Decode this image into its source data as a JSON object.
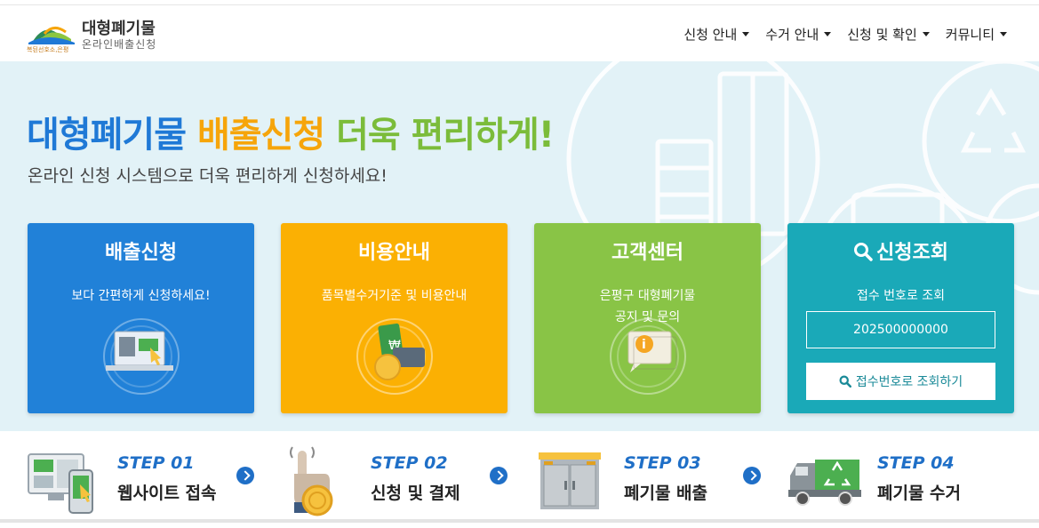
{
  "header": {
    "logo_title": "대형폐기물",
    "logo_subtitle": "온라인배출신청",
    "logo_tiny": "복된선호소,은평",
    "nav": [
      {
        "label": "신청 안내"
      },
      {
        "label": "수거 안내"
      },
      {
        "label": "신청 및 확인"
      },
      {
        "label": "커뮤니티"
      }
    ]
  },
  "hero": {
    "title_part1": "대형폐기물",
    "title_part2": "배출신청",
    "title_part3": "더욱 편리하게!",
    "subtitle": "온라인 신청 시스템으로 더욱 편리하게 신청하세요!",
    "colors": {
      "blue": "#1f79d6",
      "orange": "#f6a50a",
      "green": "#7bbc3a"
    }
  },
  "cards": [
    {
      "title": "배출신청",
      "desc": "보다 간편하게 신청하세요!",
      "color": "#2181d8",
      "icon": "laptop-icon"
    },
    {
      "title": "비용안내",
      "desc": "품목별수거기준 및 비용안내",
      "color": "#fbb003",
      "icon": "money-icon"
    },
    {
      "title": "고객센터",
      "desc_line1": "은평구 대형폐기물",
      "desc_line2": "공지 및 문의",
      "color": "#89c446",
      "icon": "info-chat-icon"
    },
    {
      "title": "신청조회",
      "desc": "접수 번호로 조회",
      "input_value": "202500000000",
      "button_label": "접수번호로 조회하기",
      "color": "#1aa9b8",
      "icon": "search-icon"
    }
  ],
  "steps": [
    {
      "num": "STEP 01",
      "label": "웹사이트 접속",
      "icon": "computer-phone-icon"
    },
    {
      "num": "STEP 02",
      "label": "신청 및 결제",
      "icon": "touch-coin-icon"
    },
    {
      "num": "STEP 03",
      "label": "폐기물 배출",
      "icon": "cabinet-icon"
    },
    {
      "num": "STEP 04",
      "label": "폐기물 수거",
      "icon": "recycle-truck-icon"
    }
  ]
}
